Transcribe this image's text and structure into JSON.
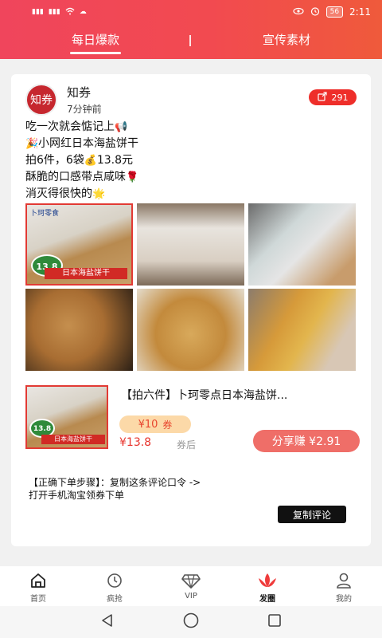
{
  "status": {
    "time": "2:11",
    "battery": "56",
    "left": "46 46"
  },
  "tabs": [
    {
      "label": "每日爆款"
    },
    {
      "label": "宣传素材"
    }
  ],
  "post": {
    "author": "知券",
    "avatar_text": "知券",
    "time_ago": "7分钟前",
    "share_count": "291",
    "lines": [
      {
        "text": "吃一次就会惦记上",
        "emoji_after": "📢"
      },
      {
        "emoji_before": "🎉",
        "text": "小网红日本海盐饼干"
      },
      {
        "text": "拍6件，6袋",
        "emoji_mid": "💰",
        "text2": "13.8元"
      },
      {
        "text": "酥脆的口感带点咸味",
        "emoji_after": "🌹"
      },
      {
        "text": "消灭得很快的",
        "emoji_after": "🌟"
      }
    ],
    "photo_overlay": {
      "brand": "卜珂零食",
      "price": "13.8",
      "strip": "日本海盐饼干"
    }
  },
  "product": {
    "title": "【拍六件】卜珂零点日本海盐饼...",
    "coupon_value": "¥10",
    "coupon_unit": "券",
    "final_price": "¥13.8",
    "after_coupon": "券后",
    "share_earn": "分享赚 ¥2.91",
    "thumb_price": "13.8",
    "thumb_strip": "日本海盐饼干"
  },
  "steps_line1": "【正确下单步骤】：复制这条评论口令 ->",
  "steps_line2": "打开手机淘宝领券下单",
  "copy_label": "复制评论",
  "nav": [
    {
      "label": "首页",
      "icon": "home-icon"
    },
    {
      "label": "疯抢",
      "icon": "clock-icon"
    },
    {
      "label": "VIP",
      "icon": "diamond-icon"
    },
    {
      "label": "发圈",
      "icon": "lotus-icon"
    },
    {
      "label": "我的",
      "icon": "user-icon"
    }
  ],
  "colors": {
    "accent": "#ee2e2a",
    "header_start": "#f0455c",
    "header_end": "#ef5a3b"
  }
}
